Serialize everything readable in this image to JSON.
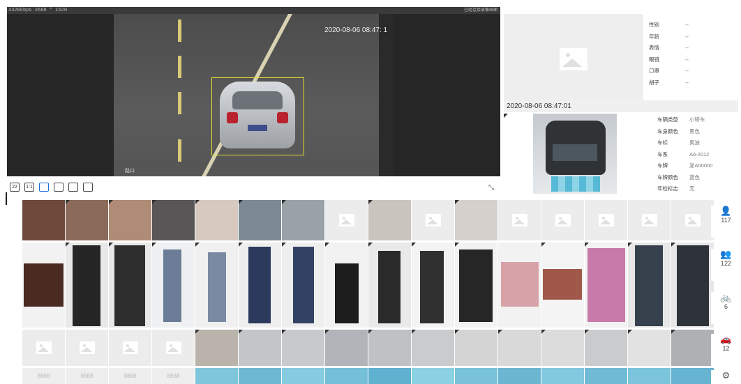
{
  "video": {
    "resolution": "4320kbps  2688 * 1520",
    "right_info": "已经连接录像画面",
    "timestamp": "2020-08-06 08:47:  1",
    "watermark": "路口"
  },
  "video_toolbar": {
    "buttons": [
      "22",
      "1:1",
      "",
      "",
      "",
      ""
    ],
    "fullscreen_icon": "expand-icon"
  },
  "face_panel": {
    "attributes": [
      {
        "label": "性别",
        "value": "--"
      },
      {
        "label": "年龄",
        "value": "--"
      },
      {
        "label": "表情",
        "value": "--"
      },
      {
        "label": "眼镜",
        "value": "--"
      },
      {
        "label": "口罩",
        "value": "--"
      },
      {
        "label": "胡子",
        "value": "--"
      }
    ]
  },
  "vehicle_panel": {
    "time": "2020-08-06 08:47:01",
    "attributes": [
      {
        "label": "车辆类型",
        "value": "小轿车"
      },
      {
        "label": "车身颜色",
        "value": "黑色"
      },
      {
        "label": "车标",
        "value": "奥迪"
      },
      {
        "label": "车系",
        "value": "A6-2012"
      },
      {
        "label": "车牌",
        "value": "浙A00000"
      },
      {
        "label": "车牌颜色",
        "value": "蓝色"
      },
      {
        "label": "年检标志",
        "value": "无"
      }
    ]
  },
  "categories": [
    {
      "name": "face",
      "icon": "person-icon",
      "glyph": "👤",
      "count": "117"
    },
    {
      "name": "body",
      "icon": "people-icon",
      "glyph": "👥",
      "count": "122"
    },
    {
      "name": "non-motor",
      "icon": "bicycle-icon",
      "glyph": "🚲",
      "count": "6"
    },
    {
      "name": "vehicle",
      "icon": "car-icon",
      "glyph": "🚗",
      "count": "12"
    },
    {
      "name": "settings",
      "icon": "gear-icon",
      "glyph": "⚙",
      "count": ""
    }
  ],
  "colors": {
    "accent": "#1e6fd9",
    "bbox": "#e4df2f",
    "placeholder": "#eeeeee"
  },
  "plate_placeholder": "8888"
}
